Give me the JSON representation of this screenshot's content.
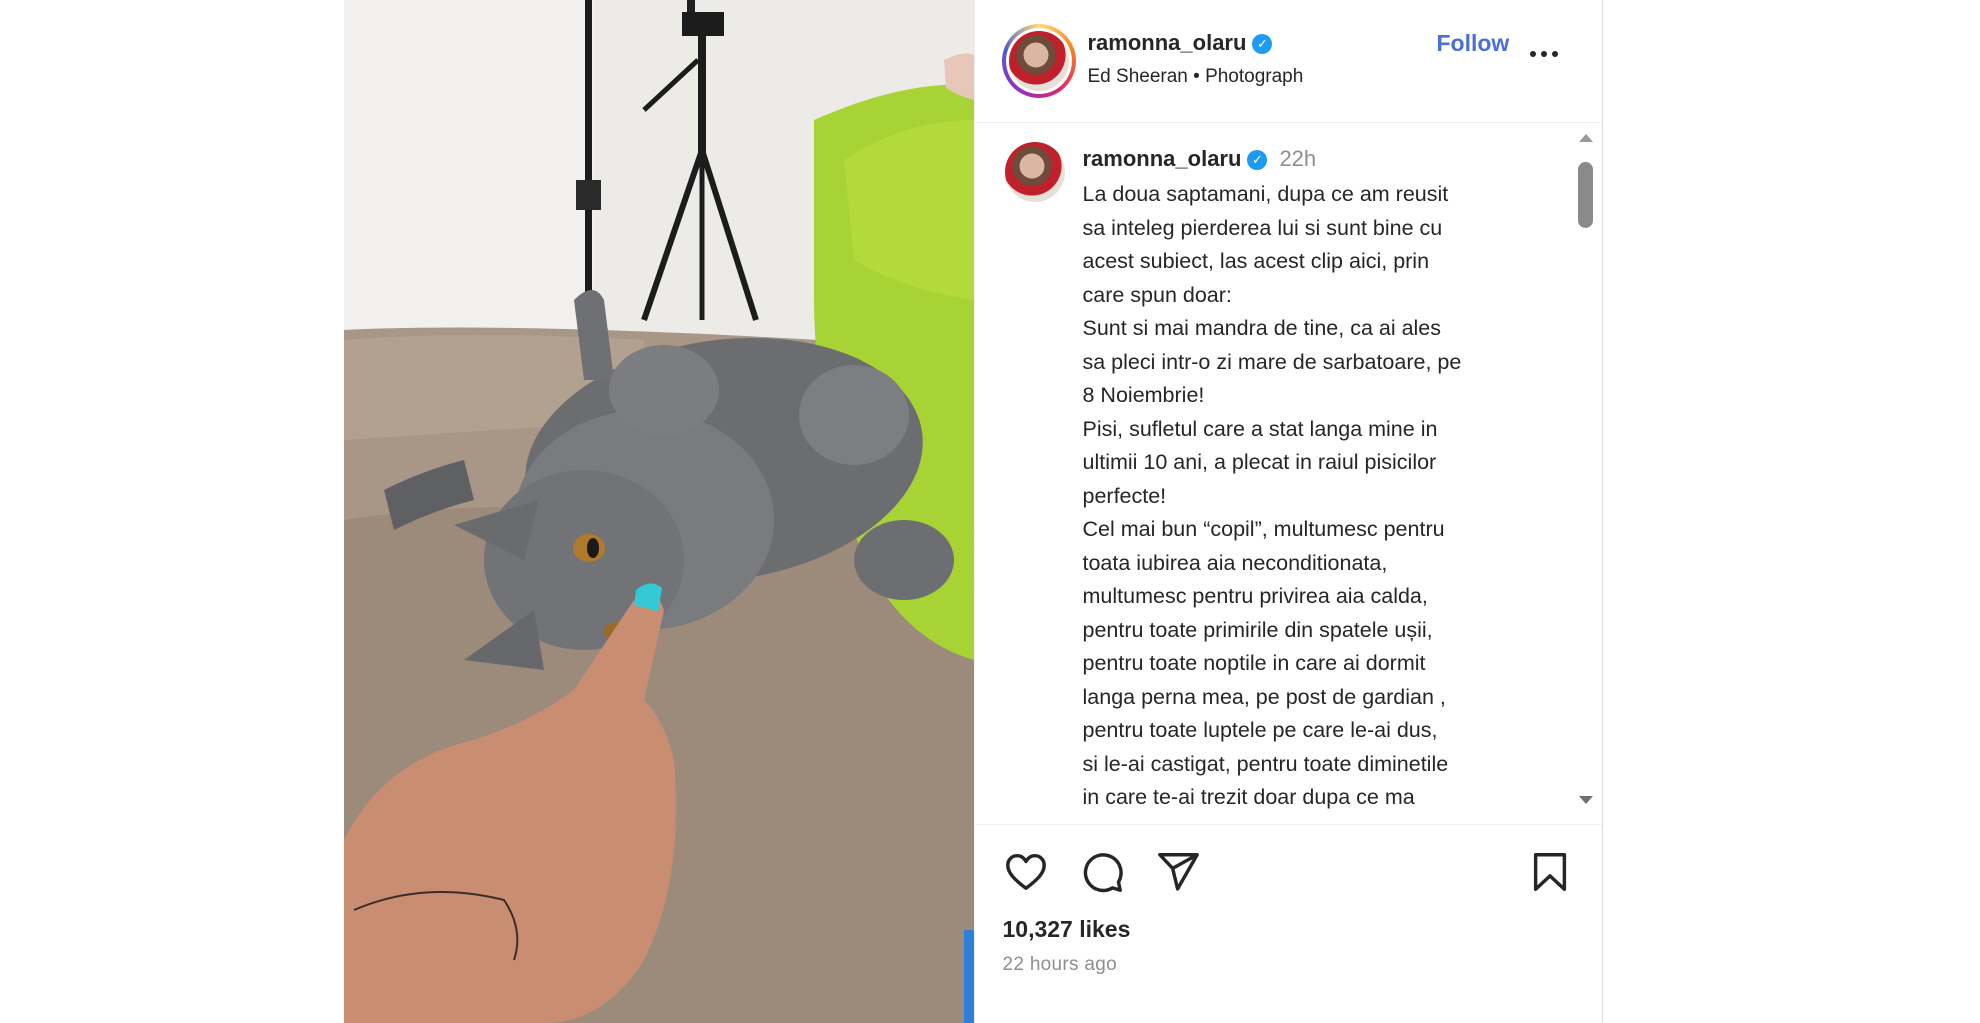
{
  "header": {
    "username": "ramonna_olaru",
    "verified_glyph": "✓",
    "subline": "Ed Sheeran • Photograph",
    "follow_label": "Follow"
  },
  "comment": {
    "username": "ramonna_olaru",
    "time": "22h",
    "lines": [
      "La doua saptamani, dupa ce am reusit",
      "sa inteleg pierderea lui si sunt bine cu",
      "acest subiect, las acest clip aici, prin",
      "care spun doar:",
      "Sunt si mai mandra de tine, ca ai ales",
      "sa pleci intr-o zi mare de sarbatoare, pe",
      "8 Noiembrie!",
      "Pisi, sufletul care a stat langa mine in",
      "ultimii 10 ani, a plecat in raiul pisicilor",
      "perfecte!",
      "Cel mai bun “copil”, multumesc pentru",
      "toata iubirea aia neconditionata,",
      "multumesc pentru privirea aia calda,",
      "pentru toate primirile din spatele ușii,",
      "pentru toate noptile in care ai dormit",
      "langa perna mea, pe post de gardian ,",
      "pentru toate luptele pe care le-ai dus,",
      "si le-ai castigat, pentru toate diminetile",
      "in care te-ai trezit doar dupa ce ma"
    ]
  },
  "footer": {
    "likes": "10,327 likes",
    "time_ago": "22 hours ago"
  },
  "icons": [
    "heart-icon",
    "comment-icon",
    "share-icon",
    "bookmark-icon",
    "more-options-icon",
    "verified-badge-icon"
  ],
  "colors": {
    "follow": "#4a6fd6",
    "verified": "#1d9bf0",
    "nail": "#35c9d6"
  }
}
